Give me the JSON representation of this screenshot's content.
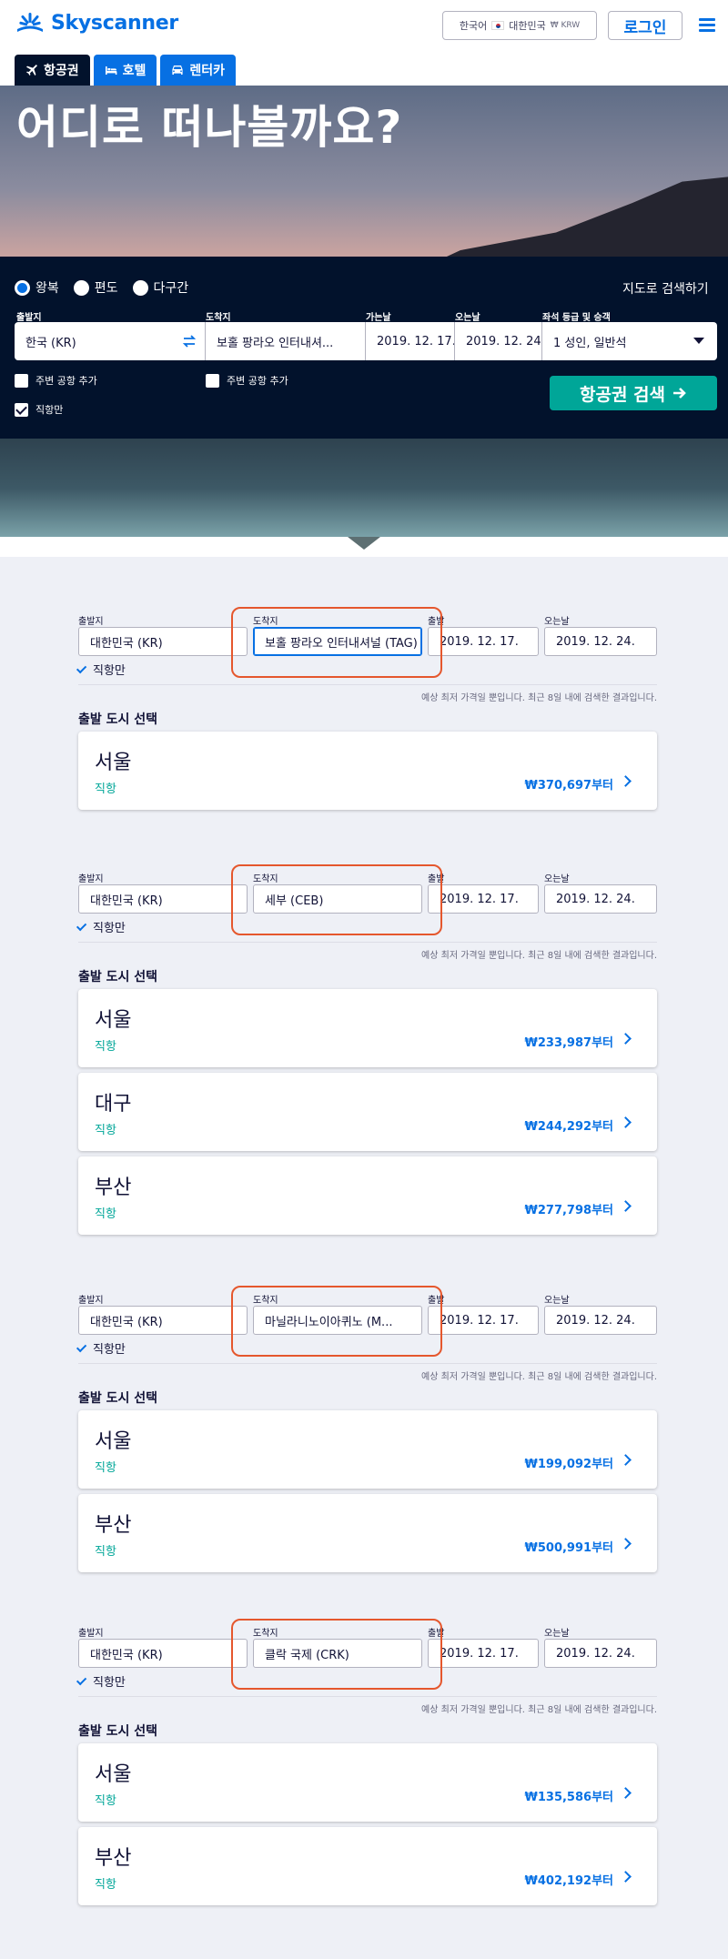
{
  "header": {
    "logo_text": "Skyscanner",
    "locale_lang": "한국어",
    "locale_country": "대한민국",
    "locale_currency": "₩ KRW",
    "login_label": "로그인"
  },
  "tabs": [
    {
      "label": "항공권",
      "icon": "airplane-icon",
      "active": true
    },
    {
      "label": "호텔",
      "icon": "bed-icon",
      "active": false
    },
    {
      "label": "렌터카",
      "icon": "car-icon",
      "active": false
    }
  ],
  "hero": {
    "title": "어디로 떠나볼까요?"
  },
  "search": {
    "trip_types": [
      {
        "label": "왕복",
        "checked": true
      },
      {
        "label": "편도",
        "checked": false
      },
      {
        "label": "다구간",
        "checked": false
      }
    ],
    "map_link": "지도로 검색하기",
    "from_label": "출발지",
    "to_label": "도착지",
    "depart_label": "가는날",
    "return_label": "오는날",
    "cabin_label": "좌석 등급 및 승객",
    "from_value": "한국 (KR)",
    "to_value": "보홀 팡라오 인터내셔...",
    "depart_value": "2019. 12. 17.",
    "return_value": "2019. 12. 24.",
    "cabin_value": "1 성인, 일반석",
    "nearby_from": "주변 공항 추가",
    "nearby_to": "주변 공항 추가",
    "direct_only": "직항만",
    "search_button": "항공권 검색",
    "colors": {
      "panel": "#02122c",
      "button": "#00a698",
      "brand": "#0770e3"
    }
  },
  "results": [
    {
      "from_label": "출발지",
      "from": "대한민국 (KR)",
      "to_label": "도착지",
      "to": "보홀 팡라오 인터내셔널 (TAG)",
      "depart_label": "출발",
      "depart": "2019. 12. 17.",
      "return_label": "오는날",
      "return": "2019. 12. 24.",
      "direct": "직항만",
      "note": "예상 최저 가격일 뿐입니다. 최근 8일 내에 검색한 결과입니다.",
      "heading": "출발 도시 선택",
      "cities": [
        {
          "name": "서울",
          "type": "직항",
          "price": "₩370,697부터"
        }
      ]
    },
    {
      "from_label": "출발지",
      "from": "대한민국 (KR)",
      "to_label": "도착지",
      "to": "세부 (CEB)",
      "depart_label": "출발",
      "depart": "2019. 12. 17.",
      "return_label": "오는날",
      "return": "2019. 12. 24.",
      "direct": "직항만",
      "note": "예상 최저 가격일 뿐입니다. 최근 8일 내에 검색한 결과입니다.",
      "heading": "출발 도시 선택",
      "cities": [
        {
          "name": "서울",
          "type": "직항",
          "price": "₩233,987부터"
        },
        {
          "name": "대구",
          "type": "직항",
          "price": "₩244,292부터"
        },
        {
          "name": "부산",
          "type": "직항",
          "price": "₩277,798부터"
        }
      ]
    },
    {
      "from_label": "출발지",
      "from": "대한민국 (KR)",
      "to_label": "도착지",
      "to": "마닐라니노이아퀴노 (M...",
      "depart_label": "출발",
      "depart": "2019. 12. 17.",
      "return_label": "오는날",
      "return": "2019. 12. 24.",
      "direct": "직항만",
      "note": "예상 최저 가격일 뿐입니다. 최근 8일 내에 검색한 결과입니다.",
      "heading": "출발 도시 선택",
      "cities": [
        {
          "name": "서울",
          "type": "직항",
          "price": "₩199,092부터"
        },
        {
          "name": "부산",
          "type": "직항",
          "price": "₩500,991부터"
        }
      ]
    },
    {
      "from_label": "출발지",
      "from": "대한민국 (KR)",
      "to_label": "도착지",
      "to": "클락 국제 (CRK)",
      "depart_label": "출발",
      "depart": "2019. 12. 17.",
      "return_label": "오는날",
      "return": "2019. 12. 24.",
      "direct": "직항만",
      "note": "예상 최저 가격일 뿐입니다. 최근 8일 내에 검색한 결과입니다.",
      "heading": "출발 도시 선택",
      "cities": [
        {
          "name": "서울",
          "type": "직항",
          "price": "₩135,586부터"
        },
        {
          "name": "부산",
          "type": "직항",
          "price": "₩402,192부터"
        }
      ]
    }
  ]
}
